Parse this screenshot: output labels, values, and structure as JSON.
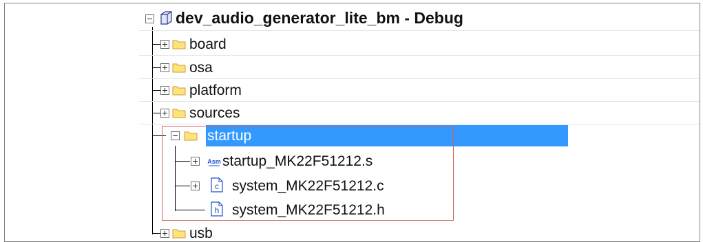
{
  "tree": {
    "root": {
      "label": "dev_audio_generator_lite_bm - Debug",
      "expander": "minus",
      "icon": "project-cube-icon"
    },
    "items": [
      {
        "label": "board",
        "expander": "plus",
        "icon": "folder-icon"
      },
      {
        "label": "osa",
        "expander": "plus",
        "icon": "folder-icon"
      },
      {
        "label": "platform",
        "expander": "plus",
        "icon": "folder-icon"
      },
      {
        "label": "sources",
        "expander": "plus",
        "icon": "folder-icon"
      },
      {
        "label": "startup",
        "expander": "minus",
        "icon": "folder-icon",
        "selected": true,
        "children": [
          {
            "label": "startup_MK22F51212.s",
            "expander": "plus",
            "icon": "asm-file-icon",
            "icon_text": "Asm"
          },
          {
            "label": "system_MK22F51212.c",
            "expander": "plus",
            "icon": "c-file-icon",
            "icon_text": "c"
          },
          {
            "label": "system_MK22F51212.h",
            "expander": "none",
            "icon": "h-file-icon",
            "icon_text": "h"
          }
        ]
      },
      {
        "label": "usb",
        "expander": "plus",
        "icon": "folder-icon"
      }
    ]
  },
  "colors": {
    "selection": "#3399ff",
    "highlight_box": "#d06060",
    "folder_fill": "#ffe27a",
    "folder_stroke": "#c8a23a",
    "file_icon": "#1f4fd1"
  }
}
